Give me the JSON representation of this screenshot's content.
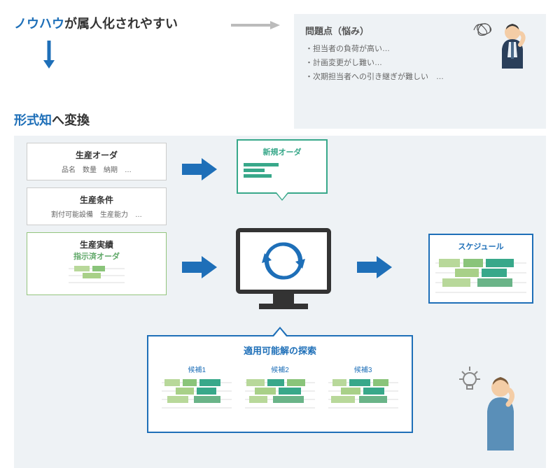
{
  "headline1": {
    "blue": "ノウハウ",
    "rest": "が属人化されやすい"
  },
  "headline2": {
    "blue": "形式知",
    "rest": "へ変換"
  },
  "problem": {
    "title": "問題点（悩み）",
    "items": [
      "・担当者の負荷が高い…",
      "・計画変更がし難い…",
      "・次期担当者への引き継ぎが難しい　…"
    ]
  },
  "inputs": {
    "order": {
      "title": "生産オーダ",
      "sub": "品名　数量　納期　…"
    },
    "cond": {
      "title": "生産条件",
      "sub": "割付可能設備　生産能力　…"
    },
    "result": {
      "title": "生産実績",
      "sub": "指示済オーダ"
    }
  },
  "newOrder": {
    "title": "新規オーダ"
  },
  "schedule": {
    "title": "スケジュール"
  },
  "search": {
    "title": "適用可能解の探索",
    "cand1": "候補1",
    "cand2": "候補2",
    "cand3": "候補3"
  },
  "colors": {
    "blue": "#1e6fb8",
    "green": "#38a88a",
    "bg": "#eef2f5"
  }
}
